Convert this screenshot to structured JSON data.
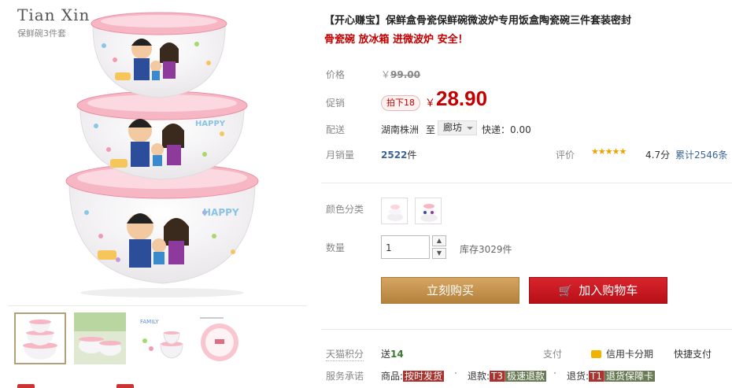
{
  "brand": {
    "name": "Tian Xin",
    "subtitle": "保鲜碗3件套"
  },
  "product": {
    "title": "【开心赚宝】保鲜盒骨瓷保鲜碗微波炉专用饭盒陶瓷碗三件套装密封",
    "subtitle": "骨瓷碗 放冰箱 进微波炉 安全！"
  },
  "price": {
    "label": "价格",
    "currency": "￥",
    "original": "99.00",
    "promo_label": "促销",
    "promo_badge": "拍下18",
    "promo_currency": "￥",
    "promo_value": "28.90"
  },
  "shipping": {
    "label": "配送",
    "from": "湖南株洲",
    "to_label": "至",
    "to_value": "廊坊",
    "fee": "快递：0.00"
  },
  "sales": {
    "label": "月销量",
    "count": "2522",
    "unit": "件"
  },
  "rating": {
    "label": "评价",
    "stars": "★★★★★",
    "score": "4.7分",
    "total": "累计2546条"
  },
  "options": {
    "color_label": "颜色分类"
  },
  "quantity": {
    "label": "数量",
    "value": "1",
    "up": "▲",
    "down": "▼",
    "stock": "库存3029件"
  },
  "actions": {
    "buy": "立刻购买",
    "cart": "加入购物车",
    "cart_icon": "cart-icon"
  },
  "points": {
    "label": "天猫积分",
    "prefix": "送",
    "value": "14"
  },
  "payment": {
    "label": "支付",
    "credit": "信用卡分期",
    "quick": "快捷支付"
  },
  "service": {
    "label": "服务承诺",
    "goods_label": "商品:",
    "goods_tag": "按时发货",
    "refund_label": "退款:",
    "refund_code": "T3",
    "refund_tag": "极速退款",
    "return_label": "退货:",
    "return_code": "T1",
    "return_tag": "退货保障卡"
  },
  "colors": {
    "accent_red": "#c40000",
    "buy_gold": "#c89850",
    "cart_red": "#c81820",
    "link_blue": "#3c6496"
  }
}
